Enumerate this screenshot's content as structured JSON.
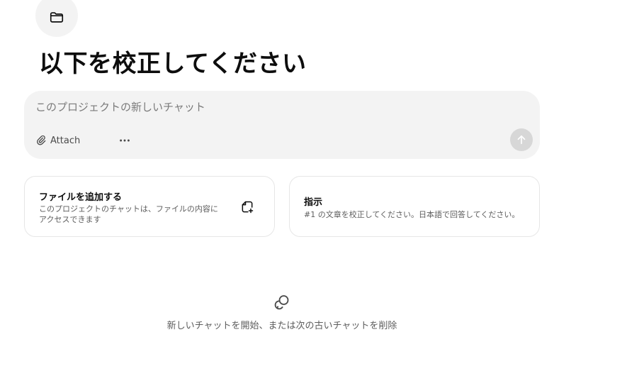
{
  "project": {
    "icon": "folder-icon",
    "title": "以下を校正してください"
  },
  "composer": {
    "placeholder": "このプロジェクトの新しいチャット",
    "attach_label": "Attach",
    "more_icon": "more-horizontal-icon",
    "send_icon": "arrow-up-icon"
  },
  "cards": {
    "files": {
      "title": "ファイルを追加する",
      "description": "このプロジェクトのチャットは、ファイルの内容にアクセスできます",
      "icon": "add-file-icon"
    },
    "instructions": {
      "title": "指示",
      "description": "#1 の文章を校正してください。日本語で回答してください。"
    }
  },
  "empty_state": {
    "icon": "chat-bubbles-icon",
    "text": "新しいチャットを開始、または次の古いチャットを削除"
  }
}
